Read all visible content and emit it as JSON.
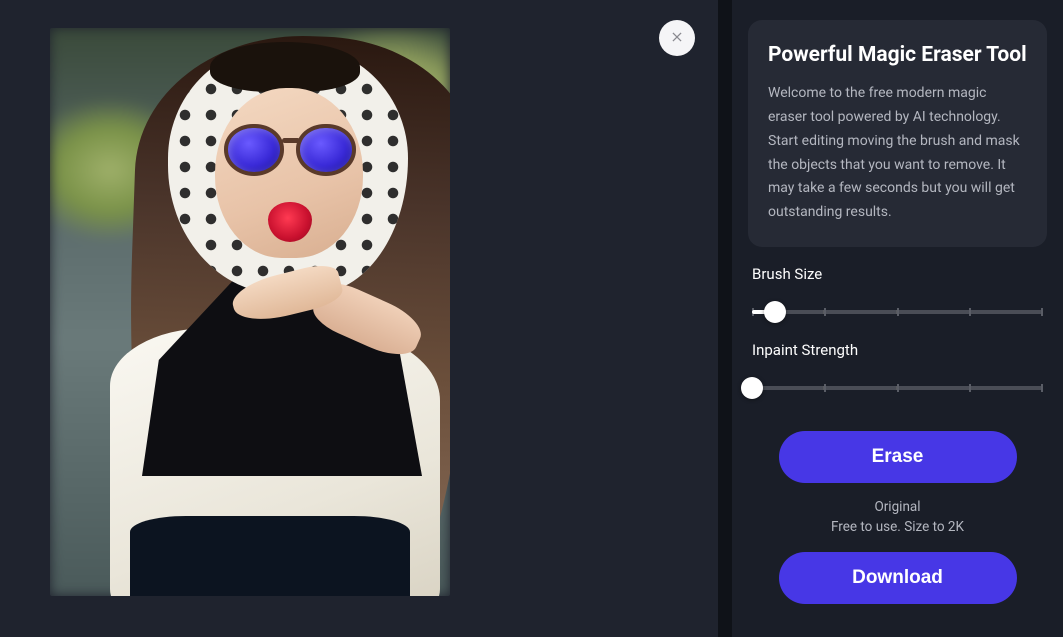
{
  "panel": {
    "title": "Powerful Magic Eraser Tool",
    "description": "Welcome to the free modern magic eraser tool powered by AI technology. Start editing moving the brush and mask the objects that you want to remove. It may take a few seconds but you will get outstanding results."
  },
  "controls": {
    "brush": {
      "label": "Brush Size",
      "value": 8,
      "min": 0,
      "max": 100
    },
    "inpaint": {
      "label": "Inpaint Strength",
      "value": 0,
      "min": 0,
      "max": 100
    }
  },
  "buttons": {
    "erase": "Erase",
    "download": "Download"
  },
  "meta": {
    "line1": "Original",
    "line2": "Free to use. Size to 2K"
  },
  "icons": {
    "close": "close-icon"
  }
}
